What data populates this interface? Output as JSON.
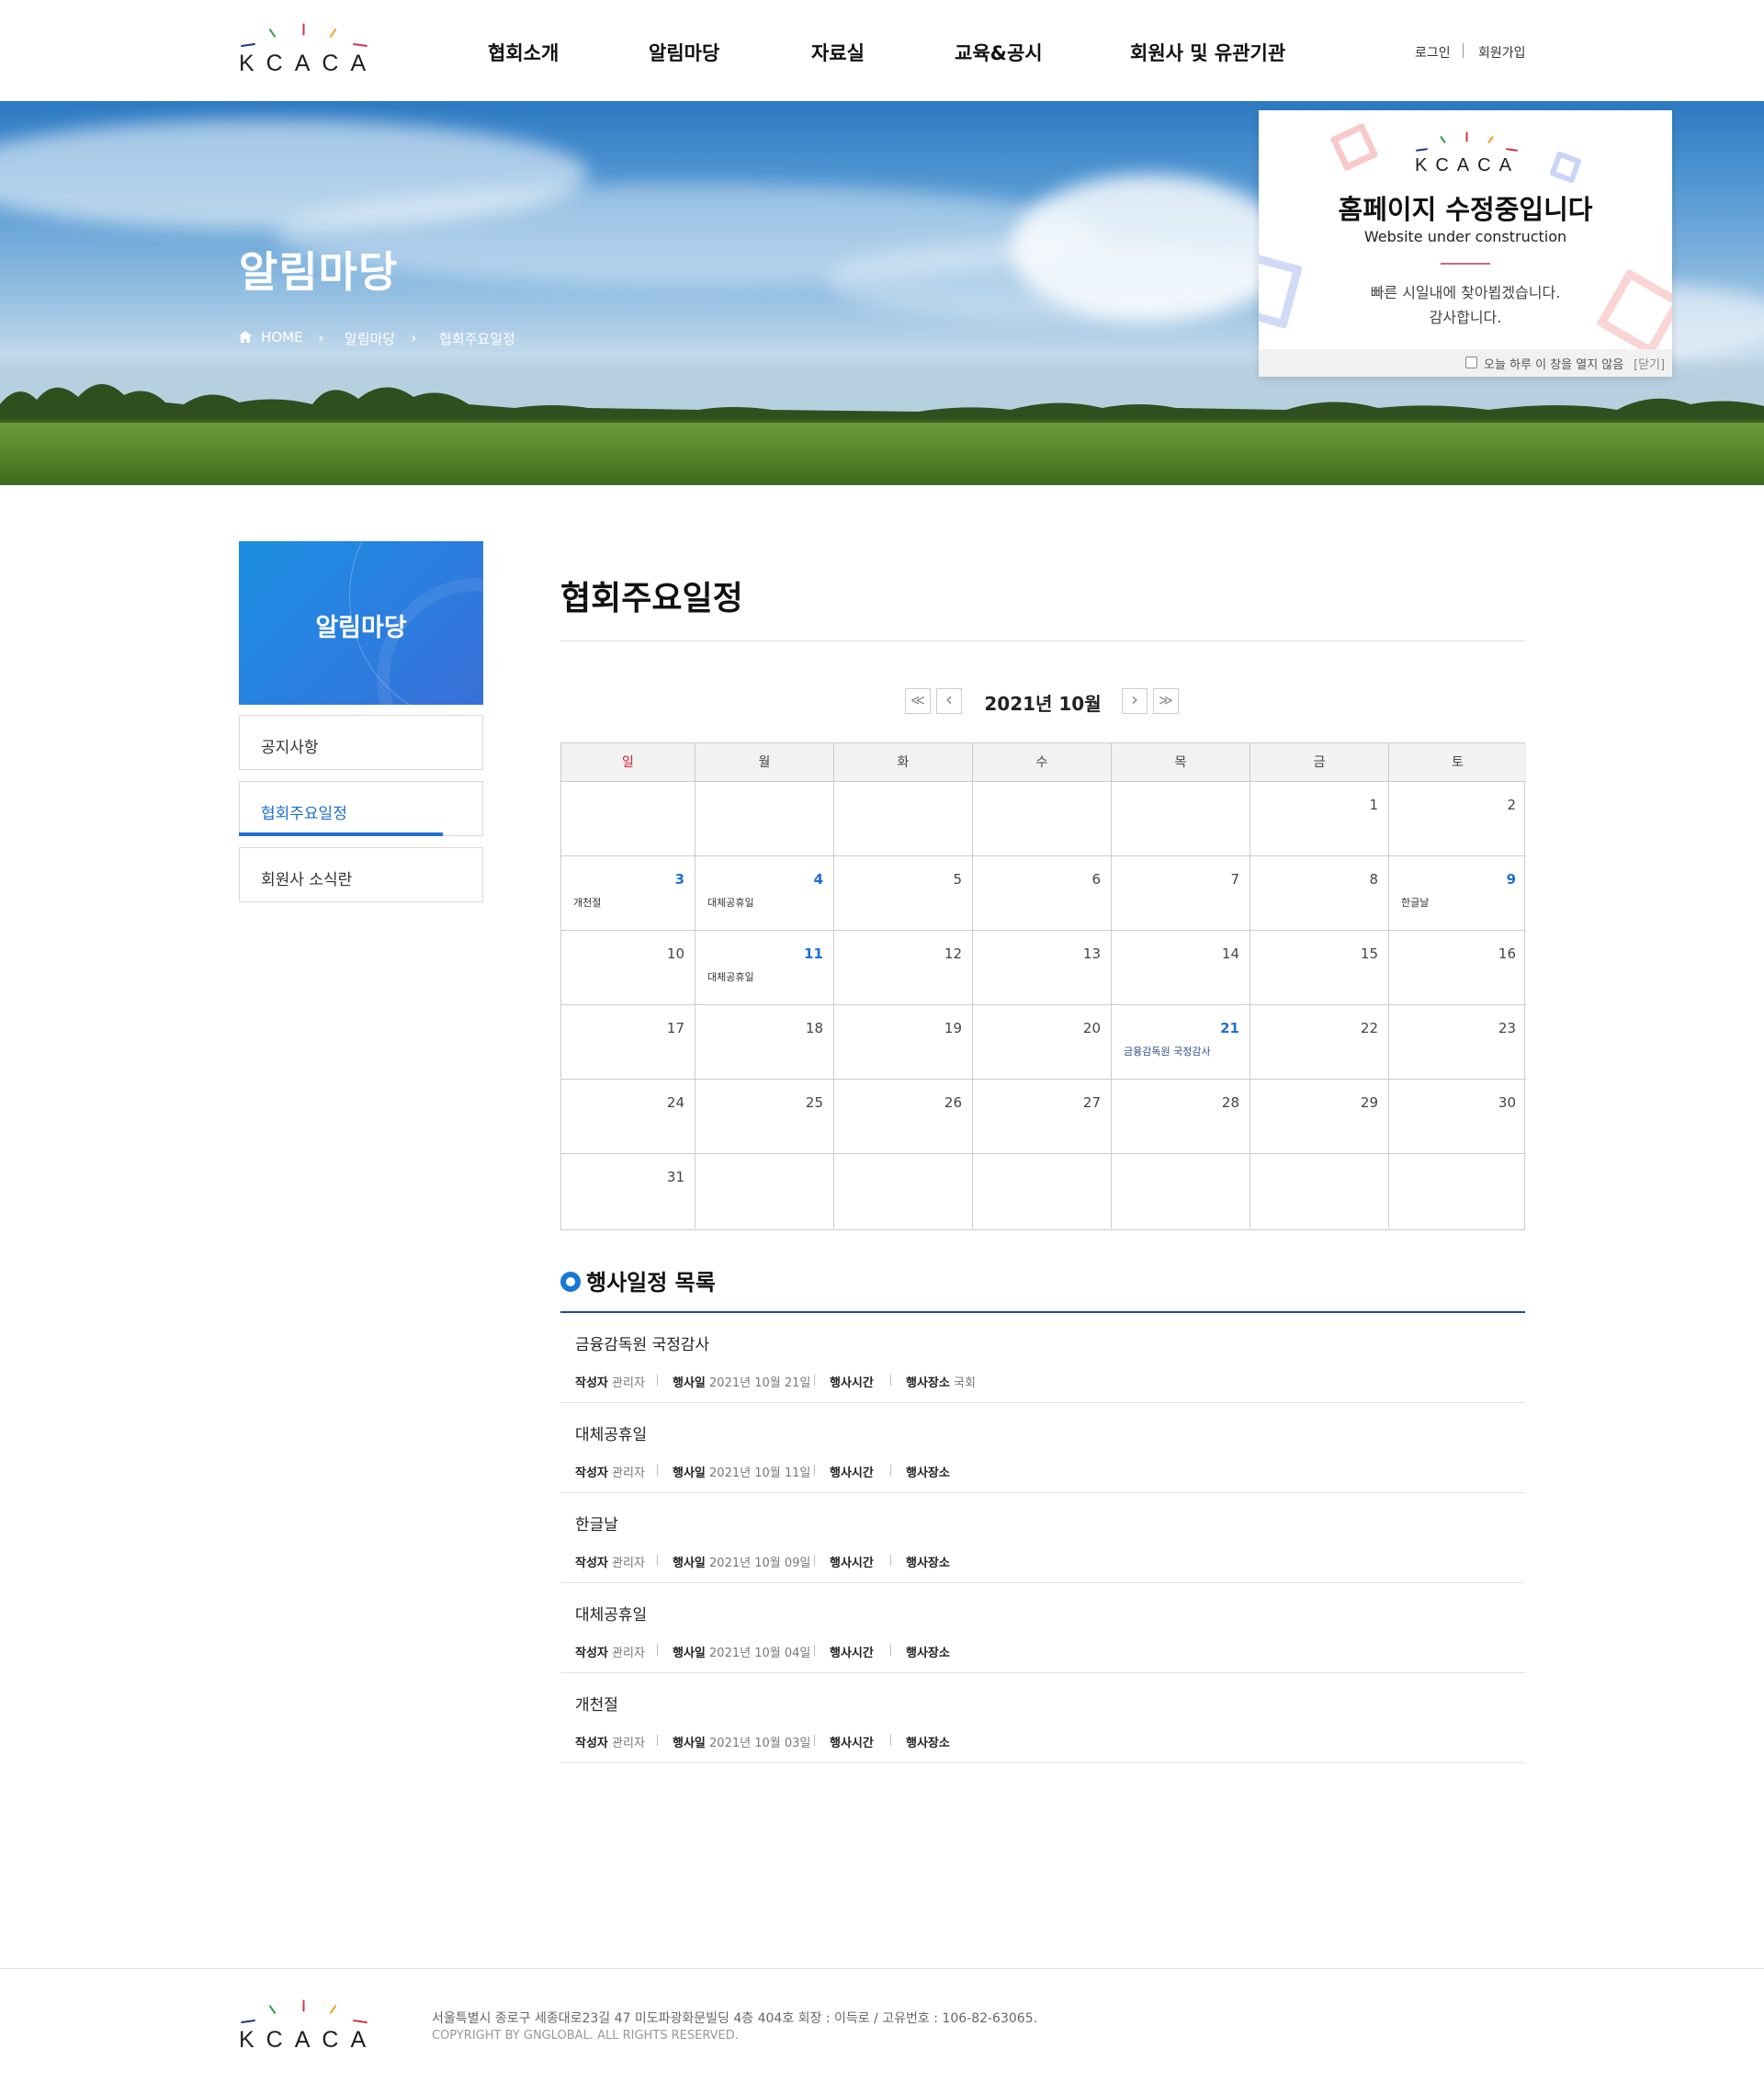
{
  "brand": {
    "logo_text": "KCACA",
    "ray_colors": [
      "#1f3a7a",
      "#2f9a4a",
      "#d4324a",
      "#f0a21c",
      "#d4324a"
    ]
  },
  "header": {
    "nav": [
      "협회소개",
      "알림마당",
      "자료실",
      "교육&공시",
      "회원사 및 유관기관"
    ],
    "login": "로그인",
    "signup": "회원가입"
  },
  "hero": {
    "title": "알림마당",
    "breadcrumb": [
      "HOME",
      "알림마당",
      "협회주요일정"
    ]
  },
  "popup": {
    "logo_text": "KCACA",
    "title": "홈페이지 수정중입니다",
    "subtitle": "Website under construction",
    "message_line1": "빠른 시일내에 찾아뵙겠습니다.",
    "message_line2": "감사합니다.",
    "dont_show_today": "오늘 하루 이 창을 열지 않음",
    "close": "[닫기]"
  },
  "sidebar": {
    "title": "알림마당",
    "items": [
      {
        "label": "공지사항",
        "active": false
      },
      {
        "label": "협회주요일정",
        "active": true
      },
      {
        "label": "회원사 소식란",
        "active": false
      }
    ]
  },
  "page": {
    "title": "협회주요일정"
  },
  "calendar": {
    "month_label": "2021년 10월",
    "nav": {
      "first": "≪",
      "prev": "‹",
      "next": "›",
      "last": "≫"
    },
    "weekdays": [
      "일",
      "월",
      "화",
      "수",
      "목",
      "금",
      "토"
    ],
    "accent_sunday": "#d11f2f",
    "weeks": [
      [
        null,
        null,
        null,
        null,
        null,
        {
          "d": "1"
        },
        {
          "d": "2"
        }
      ],
      [
        {
          "d": "3",
          "hol": true,
          "ev": "개천절"
        },
        {
          "d": "4",
          "hol": true,
          "ev": "대체공휴일"
        },
        {
          "d": "5"
        },
        {
          "d": "6"
        },
        {
          "d": "7"
        },
        {
          "d": "8"
        },
        {
          "d": "9",
          "hol": true,
          "ev": "한글날"
        }
      ],
      [
        {
          "d": "10"
        },
        {
          "d": "11",
          "hol": true,
          "ev": "대체공휴일"
        },
        {
          "d": "12"
        },
        {
          "d": "13"
        },
        {
          "d": "14"
        },
        {
          "d": "15"
        },
        {
          "d": "16"
        }
      ],
      [
        {
          "d": "17"
        },
        {
          "d": "18"
        },
        {
          "d": "19"
        },
        {
          "d": "20"
        },
        {
          "d": "21",
          "hol": true,
          "ev": "금융감독원 국정감사",
          "blue": true
        },
        {
          "d": "22"
        },
        {
          "d": "23"
        }
      ],
      [
        {
          "d": "24"
        },
        {
          "d": "25"
        },
        {
          "d": "26"
        },
        {
          "d": "27"
        },
        {
          "d": "28"
        },
        {
          "d": "29"
        },
        {
          "d": "30"
        }
      ],
      [
        {
          "d": "31"
        },
        null,
        null,
        null,
        null,
        null,
        null
      ]
    ]
  },
  "event_list": {
    "title": "행사일정 목록",
    "labels": {
      "writer": "작성자",
      "date": "행사일",
      "time": "행사시간",
      "place": "행사장소"
    },
    "items": [
      {
        "name": "금융감독원 국정감사",
        "writer": "관리자",
        "date": "2021년 10월 21일",
        "time": "",
        "place": "국회"
      },
      {
        "name": "대체공휴일",
        "writer": "관리자",
        "date": "2021년 10월 11일",
        "time": "",
        "place": ""
      },
      {
        "name": "한글날",
        "writer": "관리자",
        "date": "2021년 10월 09일",
        "time": "",
        "place": ""
      },
      {
        "name": "대체공휴일",
        "writer": "관리자",
        "date": "2021년 10월 04일",
        "time": "",
        "place": ""
      },
      {
        "name": "개천절",
        "writer": "관리자",
        "date": "2021년 10월 03일",
        "time": "",
        "place": ""
      }
    ]
  },
  "footer": {
    "logo_text": "KCACA",
    "address": "서울특별시 종로구 세종대로23길 47 미도파광화문빌딩 4층 404호  회장 : 이득로 / 고유번호 : 106-82-63065.",
    "copyright": "COPYRIGHT BY GNGLOBAL. ALL RIGHTS RESERVED."
  }
}
